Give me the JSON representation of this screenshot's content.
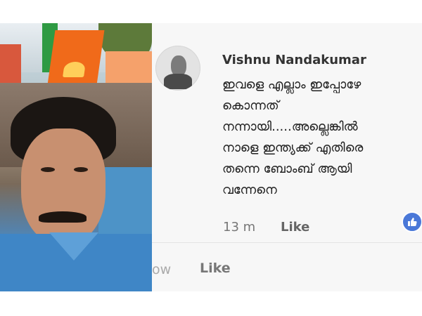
{
  "comment": {
    "author": "Vishnu Nandakumar",
    "text": "ഇവളെ എല്ലാം ഇപ്പോഴേ\nകൊന്നത്\nനന്നായി.....അല്ലെങ്കിൽ\nനാളെ ഇന്ത്യക്ക് എതിരെ\nതന്നെ ബോംബ് ആയി\nവന്നേനെ",
    "time": "13 m",
    "like_label": "Like",
    "reaction_icon": "thumbs-up-icon",
    "reaction_color": "#4a78d8"
  },
  "footer": {
    "now_fragment": "ow",
    "like_label": "Like"
  }
}
